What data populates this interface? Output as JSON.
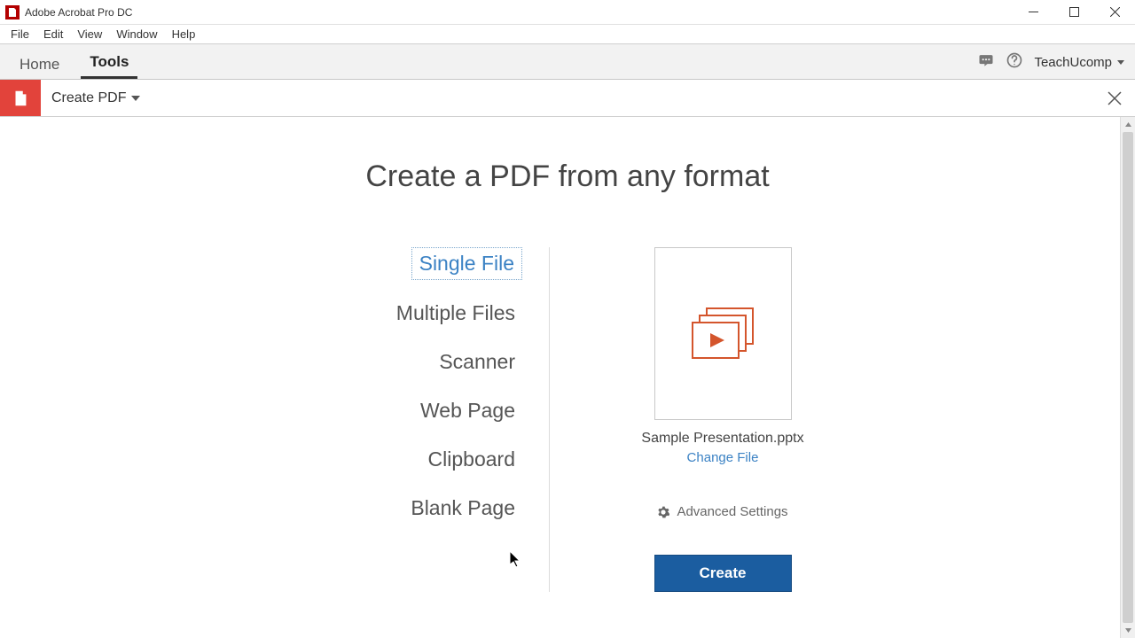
{
  "window": {
    "title": "Adobe Acrobat Pro DC"
  },
  "menu": {
    "items": [
      "File",
      "Edit",
      "View",
      "Window",
      "Help"
    ]
  },
  "tabs": {
    "home": "Home",
    "tools": "Tools",
    "user": "TeachUcomp"
  },
  "toolbar": {
    "label": "Create PDF"
  },
  "main": {
    "heading": "Create a PDF from any format",
    "options": [
      "Single File",
      "Multiple Files",
      "Scanner",
      "Web Page",
      "Clipboard",
      "Blank Page"
    ],
    "filename": "Sample Presentation.pptx",
    "change_file": "Change File",
    "advanced": "Advanced Settings",
    "create": "Create"
  }
}
